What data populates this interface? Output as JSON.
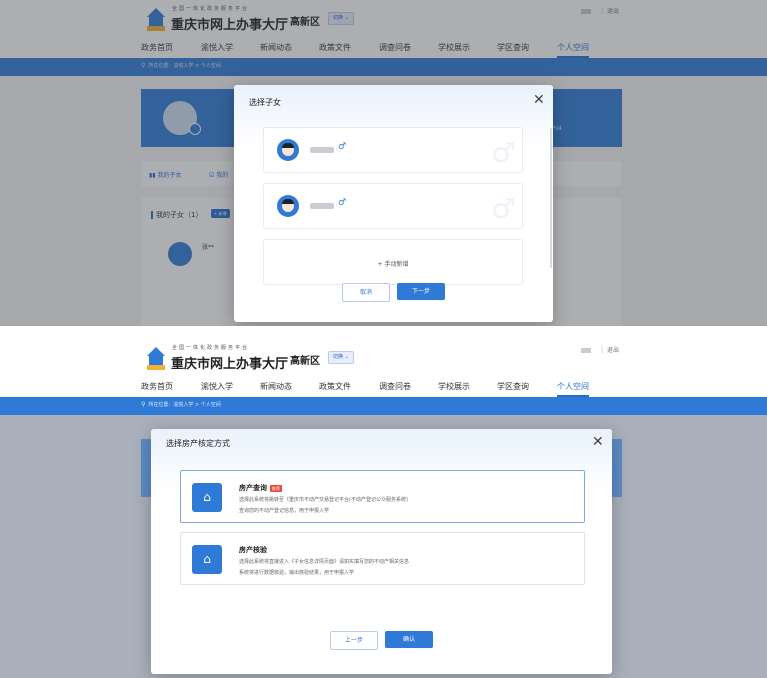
{
  "site": {
    "top_slogan": "全国一体化政务服务平台",
    "name": "重庆市网上办事大厅",
    "district": "高新区",
    "switch_label": "切换 ⌄",
    "logout": "退出"
  },
  "nav": {
    "items": [
      "政务首页",
      "渝悦入学",
      "新闻动态",
      "政策文件",
      "调查问卷",
      "学校展示",
      "学区查询",
      "个人空间"
    ],
    "active": "个人空间"
  },
  "breadcrumb": "所在位置：渝悦入学 > 个人空间",
  "background_page": {
    "phone_tail": "*14",
    "tabs": [
      "我的子女",
      "我的"
    ],
    "children_section_title": "我的子女（1）",
    "add_button": "+ 新增",
    "child_name": "张**"
  },
  "modal_select_child": {
    "title": "选择子女",
    "children": [
      {
        "gender": "♂"
      },
      {
        "gender": "♂"
      }
    ],
    "add_manual": "+ 手动新增",
    "cancel": "取消",
    "next": "下一步"
  },
  "modal_property": {
    "title": "选择房产核定方式",
    "options": [
      {
        "title": "房产查询",
        "tag": "推荐",
        "desc_line1": "选择此系统将跳转至《重庆市不动产交易登记平台(不动产登记公众服务系统)",
        "desc_line2": "查询您的不动产登记信息，用于申报入学"
      },
      {
        "title": "房产核验",
        "desc_line1": "选择此系统将直接进入《子女信息详情页面》请如实填写您的不动产相关信息",
        "desc_line2": "系统将进行数据核验，输出核验结果，用于申报入学"
      }
    ],
    "prev": "上一步",
    "confirm": "确认"
  },
  "colors": {
    "primary": "#2e7ad6",
    "tag_red": "#e94b3c"
  }
}
